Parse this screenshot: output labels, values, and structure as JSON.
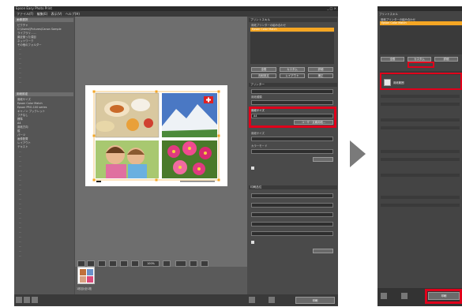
{
  "window": {
    "title": "Epson Easy Photo Print",
    "controls": "_ □ ×",
    "menu": [
      "ファイル(F)",
      "編集(E)",
      "表示(V)",
      "ヘルプ(H)"
    ]
  },
  "left_panel": {
    "sections": [
      {
        "title": "画像選択",
        "items": [
          "ピクチャ",
          "C:\\Users\\\\Pictures\\Canon Sample",
          "ライブラリ - ...",
          "最近使った項目",
          "ネットワーク",
          "その他のフォルダー"
        ]
      },
      {
        "title": "用紙設定",
        "items": [
          "用紙サイズ",
          "Epson Color Match",
          "Epson PRO-100 series",
          "キャノン ブックレット",
          "フチなし",
          "標準",
          "A4",
          "用紙方向",
          "縦",
          "パーツ",
          "画像配置",
          "レイアウト",
          "テキスト"
        ]
      }
    ]
  },
  "canvas": {
    "photos": [
      {
        "name": "breakfast-photo"
      },
      {
        "name": "mountain-photo"
      },
      {
        "name": "children-photo"
      },
      {
        "name": "flowers-photo"
      }
    ],
    "zoom": "100%"
  },
  "right_panel": {
    "header": "プリントスキル",
    "list": [
      "用紙プリンターの組み合わせ",
      "Epson Color Match"
    ],
    "tabs": [
      "全般",
      "カスタム",
      "詳細"
    ],
    "sub_tabs": [
      "用紙設定",
      "レイアウト",
      "補正"
    ],
    "sections": [
      "プリンター",
      "用紙種類",
      "用紙サイズ",
      "カラーモード",
      "印刷品位"
    ],
    "highlight_label": "用紙サイズ",
    "highlight_value": "A4",
    "highlight_button": "ユーザー定義用紙...",
    "print_button": "印刷"
  },
  "thumbnail": {
    "label": "1枚目/全1枚"
  },
  "second_window": {
    "title": "プリントスキル",
    "list": [
      "用紙プリンターの組み合わせ",
      "Epson Color Match"
    ],
    "tabs": [
      "全般",
      "カスタム",
      "詳細"
    ],
    "field": "用紙範囲",
    "print_button": "印刷"
  },
  "colors": {
    "highlight_red": "#e0001b",
    "selected_orange": "#f5a623"
  }
}
